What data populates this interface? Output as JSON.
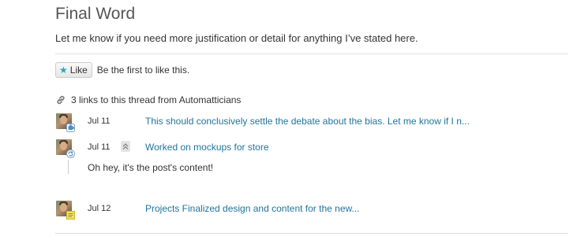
{
  "section": {
    "title": "Final Word",
    "intro": "Let me know if you need more justification or detail for anything I’ve stated here."
  },
  "like": {
    "button_label": "Like",
    "text": "Be the first to like this."
  },
  "links": {
    "header": "3 links to this thread from Automatticians",
    "items": [
      {
        "date": "Jul 11",
        "title": "This should conclusively settle the debate about the bias. Let me know if I n...",
        "icon": "puzzle-badge-icon"
      },
      {
        "date": "Jul 11",
        "title": "Worked on mockups for store",
        "icon": "refresh-badge-icon",
        "expanded": true,
        "content": "Oh hey, it's the post's content!"
      },
      {
        "date": "Jul 12",
        "title": "Projects Finalized design and content for the new...",
        "icon": "note-badge-icon"
      }
    ]
  },
  "colors": {
    "link": "#21759b",
    "star": "#2e9fd3",
    "divider": "#dddddd",
    "title": "#555555"
  }
}
